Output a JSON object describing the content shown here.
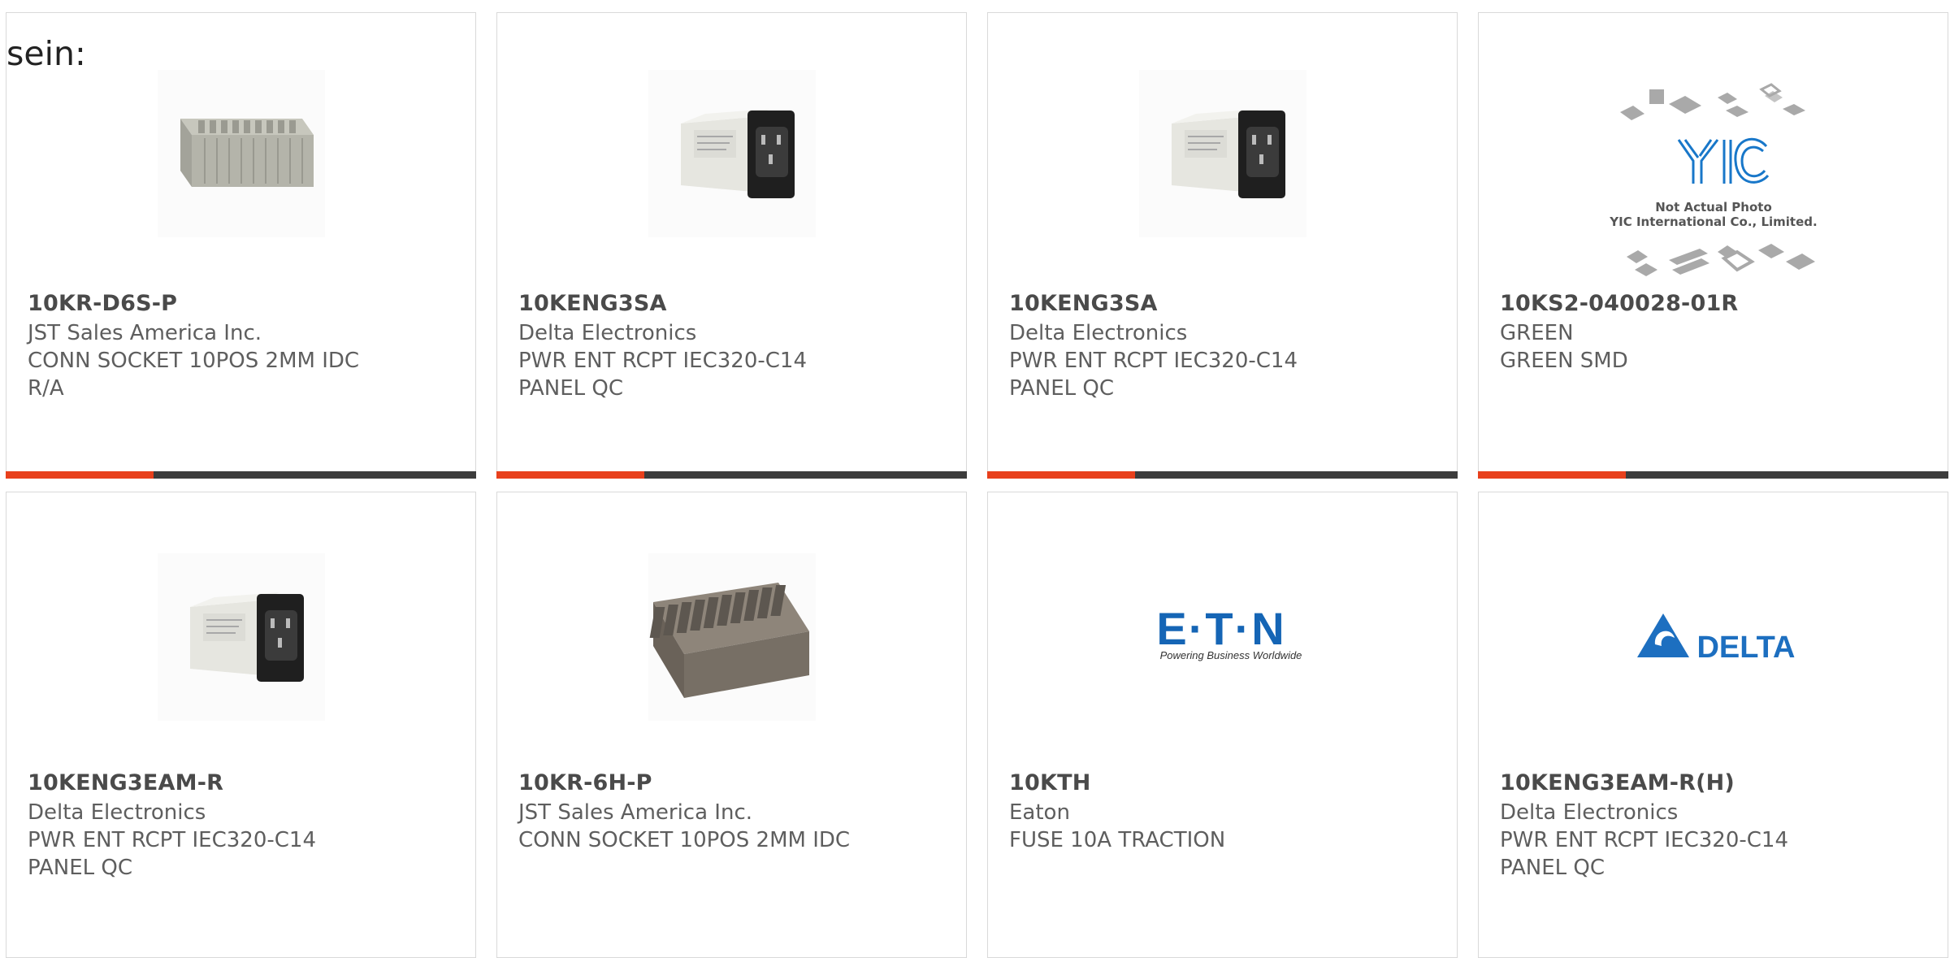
{
  "intro": {
    "text": "sein:"
  },
  "colors": {
    "accent": "#e8401c",
    "bar": "#3c3c3c",
    "border": "#d9d9d9"
  },
  "products": [
    {
      "part_number": "10KR-D6S-P",
      "manufacturer": "JST Sales America Inc.",
      "description_line1": "CONN SOCKET 10POS 2MM IDC",
      "description_line2": "R/A",
      "image": "connector-socket-photo"
    },
    {
      "part_number": "10KENG3SA",
      "manufacturer": "Delta Electronics",
      "description_line1": "PWR ENT RCPT IEC320-C14",
      "description_line2": "PANEL QC",
      "image": "power-entry-module-photo"
    },
    {
      "part_number": "10KENG3SA",
      "manufacturer": "Delta Electronics",
      "description_line1": "PWR ENT RCPT IEC320-C14",
      "description_line2": "PANEL QC",
      "image": "power-entry-module-photo"
    },
    {
      "part_number": "10KS2-040028-01R",
      "manufacturer": "GREEN",
      "description_line1": "GREEN SMD",
      "description_line2": "",
      "image": "yic-placeholder",
      "image_caption_line1": "Not Actual Photo",
      "image_caption_line2": "YIC International Co., Limited.",
      "image_logo": "YIC"
    },
    {
      "part_number": "10KENG3EAM-R",
      "manufacturer": "Delta Electronics",
      "description_line1": "PWR ENT RCPT IEC320-C14",
      "description_line2": "PANEL QC",
      "image": "power-entry-module-photo"
    },
    {
      "part_number": "10KR-6H-P",
      "manufacturer": "JST Sales America Inc.",
      "description_line1": "CONN SOCKET 10POS 2MM IDC",
      "description_line2": "",
      "image": "connector-header-photo"
    },
    {
      "part_number": "10KTH",
      "manufacturer": "Eaton",
      "description_line1": "FUSE 10A TRACTION",
      "description_line2": "",
      "image": "eaton-logo",
      "image_logo": "E·T·N",
      "image_tagline": "Powering Business Worldwide"
    },
    {
      "part_number": "10KENG3EAM-R(H)",
      "manufacturer": "Delta Electronics",
      "description_line1": "PWR ENT RCPT IEC320-C14",
      "description_line2": "PANEL QC",
      "image": "delta-logo",
      "image_logo": "DELTA"
    }
  ]
}
